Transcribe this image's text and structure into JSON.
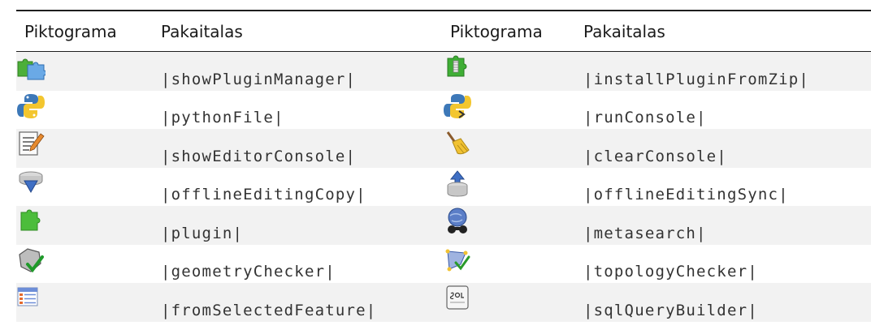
{
  "headers": [
    "Piktograma",
    "Pakaitalas",
    "Piktograma",
    "Pakaitalas"
  ],
  "rows": [
    {
      "left": {
        "icon": "plugin-manager-icon",
        "code": "|showPluginManager|"
      },
      "right": {
        "icon": "install-plugin-zip-icon",
        "code": "|installPluginFromZip|"
      }
    },
    {
      "left": {
        "icon": "python-file-icon",
        "code": "|pythonFile|"
      },
      "right": {
        "icon": "python-console-icon",
        "code": "|runConsole|"
      }
    },
    {
      "left": {
        "icon": "editor-icon",
        "code": "|showEditorConsole|"
      },
      "right": {
        "icon": "broom-icon",
        "code": "|clearConsole|"
      }
    },
    {
      "left": {
        "icon": "offline-copy-icon",
        "code": "|offlineEditingCopy|"
      },
      "right": {
        "icon": "offline-sync-icon",
        "code": "|offlineEditingSync|"
      }
    },
    {
      "left": {
        "icon": "plugin-icon",
        "code": "|plugin|"
      },
      "right": {
        "icon": "metasearch-icon",
        "code": "|metasearch|"
      }
    },
    {
      "left": {
        "icon": "geometry-checker-icon",
        "code": "|geometryChecker|"
      },
      "right": {
        "icon": "topology-checker-icon",
        "code": "|topologyChecker|"
      }
    },
    {
      "left": {
        "icon": "from-selected-feature-icon",
        "code": "|fromSelectedFeature|"
      },
      "right": {
        "icon": "sql-query-builder-icon",
        "code": "|sqlQueryBuilder|"
      }
    }
  ]
}
